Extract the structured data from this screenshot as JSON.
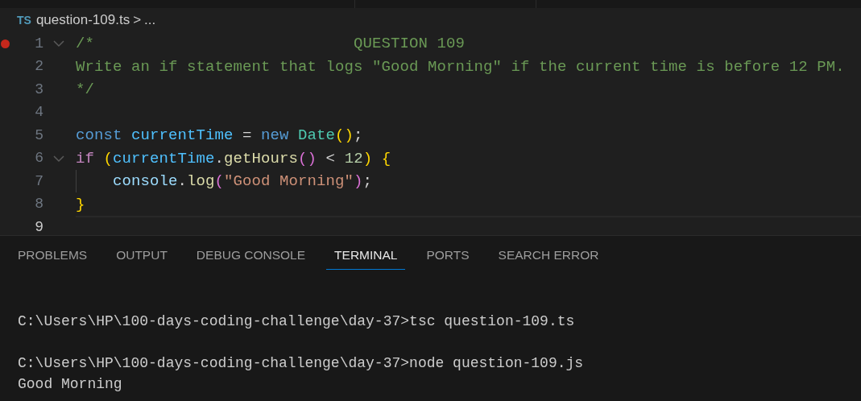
{
  "breadcrumb": {
    "file_badge": "TS",
    "file": "question-109.ts",
    "separator": ">",
    "more": "..."
  },
  "code_lines": [
    {
      "number": "1",
      "breakpoint": true,
      "fold": true,
      "current": false,
      "tokens": [
        {
          "kind": "comment",
          "text": "/*                            QUESTION 109"
        }
      ]
    },
    {
      "number": "2",
      "breakpoint": false,
      "fold": false,
      "current": false,
      "tokens": [
        {
          "kind": "comment",
          "text": "Write an if statement that logs \"Good Morning\" if the current time is before 12 PM."
        }
      ]
    },
    {
      "number": "3",
      "breakpoint": false,
      "fold": false,
      "current": false,
      "tokens": [
        {
          "kind": "comment",
          "text": "*/"
        }
      ]
    },
    {
      "number": "4",
      "breakpoint": false,
      "fold": false,
      "current": false
    },
    {
      "number": "5",
      "breakpoint": false,
      "fold": false,
      "current": false,
      "tokens": [
        {
          "kind": "storage",
          "text": "const "
        },
        {
          "kind": "constant",
          "text": "currentTime"
        },
        {
          "kind": "plain",
          "text": " = "
        },
        {
          "kind": "storage",
          "text": "new "
        },
        {
          "kind": "type",
          "text": "Date"
        },
        {
          "kind": "bracket1",
          "text": "()"
        },
        {
          "kind": "plain",
          "text": ";"
        }
      ]
    },
    {
      "number": "6",
      "breakpoint": false,
      "fold": true,
      "current": false,
      "tokens": [
        {
          "kind": "control",
          "text": "if "
        },
        {
          "kind": "bracket1",
          "text": "("
        },
        {
          "kind": "constant",
          "text": "currentTime"
        },
        {
          "kind": "plain",
          "text": "."
        },
        {
          "kind": "function",
          "text": "getHours"
        },
        {
          "kind": "bracket2",
          "text": "()"
        },
        {
          "kind": "plain",
          "text": " < "
        },
        {
          "kind": "number",
          "text": "12"
        },
        {
          "kind": "bracket1",
          "text": ") {"
        }
      ]
    },
    {
      "number": "7",
      "breakpoint": false,
      "fold": false,
      "current": false,
      "indent": true,
      "tokens": [
        {
          "kind": "variable",
          "text": "console"
        },
        {
          "kind": "plain",
          "text": "."
        },
        {
          "kind": "function",
          "text": "log"
        },
        {
          "kind": "bracket2",
          "text": "("
        },
        {
          "kind": "string",
          "text": "\"Good Morning\""
        },
        {
          "kind": "bracket2",
          "text": ")"
        },
        {
          "kind": "plain",
          "text": ";"
        }
      ]
    },
    {
      "number": "8",
      "breakpoint": false,
      "fold": false,
      "current": false,
      "tokens": [
        {
          "kind": "bracket1",
          "text": "}"
        }
      ]
    },
    {
      "number": "9",
      "breakpoint": false,
      "fold": false,
      "current": true
    }
  ],
  "panel_tabs": [
    {
      "label": "PROBLEMS",
      "selected": false
    },
    {
      "label": "OUTPUT",
      "selected": false
    },
    {
      "label": "DEBUG CONSOLE",
      "selected": false
    },
    {
      "label": "TERMINAL",
      "selected": true
    },
    {
      "label": "PORTS",
      "selected": false
    },
    {
      "label": "SEARCH ERROR",
      "selected": false
    }
  ],
  "terminal_lines": [
    "C:\\Users\\HP\\100-days-coding-challenge\\day-37>tsc question-109.ts",
    "C:\\Users\\HP\\100-days-coding-challenge\\day-37>node question-109.js",
    "Good Morning"
  ]
}
